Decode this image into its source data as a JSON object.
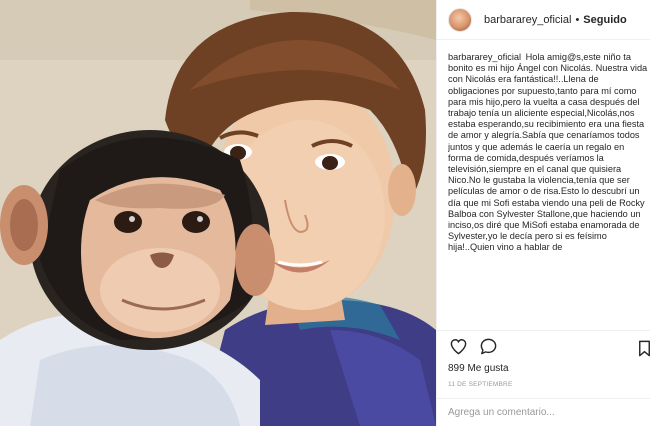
{
  "post": {
    "username": "barbararey_oficial",
    "separator": "•",
    "follow_label": "Seguido",
    "caption_username": "barbararey_oficial",
    "caption_text": "Hola amig@s,este niño ta bonito es mi hijo Ángel con Nicolás. Nuestra vida con Nicolás era fantástica!!..Llena de obligaciones por supuesto,tanto para mí como para mis hijo,pero la vuelta a casa después del trabajo tenía un aliciente especial,Nicolás,nos estaba esperando,su recibimiento era una fiesta de amor y alegría.Sabía que cenaríamos todos juntos y que además le caería un regalo en forma de comida,después veríamos la televisión,siempre en el canal que quisiera Nico.No le gustaba la violencia,tenía que ser películas de amor o de risa.Esto lo descubrí un día que mi Sofi estaba viendo una peli de Rocky Balboa con Sylvester Stallone,que haciendo un inciso,os diré que MiSofi estaba enamorada de Sylvester,yo le decía pero si es feísimo hija!..Quien vino a hablar de",
    "likes": "899 Me gusta",
    "date": "11 DE SEPTIEMBRE",
    "comment_placeholder": "Agrega un comentario..."
  },
  "icons": {
    "like": "heart-outline-icon",
    "comment": "speech-bubble-icon",
    "save": "bookmark-icon"
  },
  "colors": {
    "text": "#262626",
    "muted": "#999999",
    "border": "#efefef"
  }
}
